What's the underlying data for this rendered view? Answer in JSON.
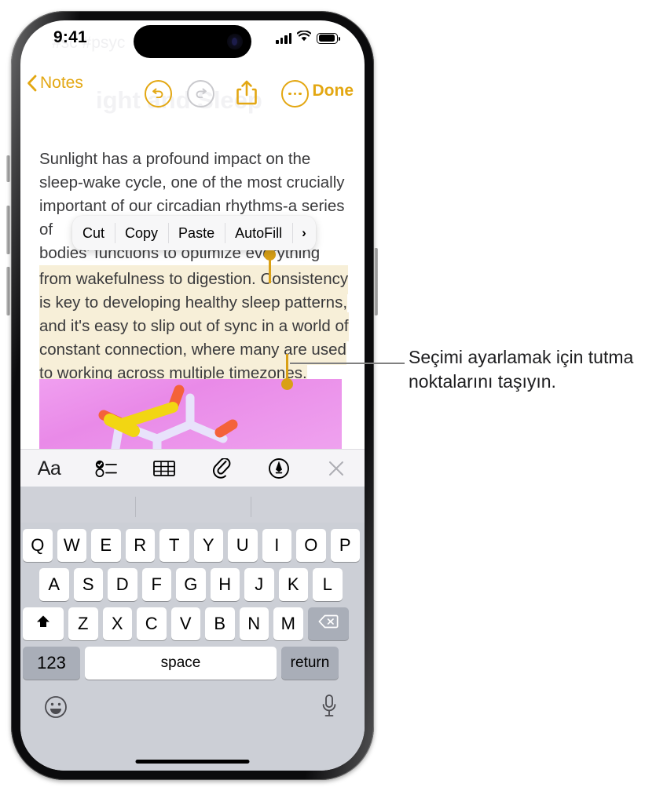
{
  "status_bar": {
    "time": "9:41",
    "signal_icon": "cellular-signal-icon",
    "wifi_icon": "wifi-icon",
    "battery_icon": "battery-full-icon"
  },
  "ghost": {
    "tags": "#sc        #psyc",
    "title": "ight and Sleep"
  },
  "nav_bar": {
    "back_label": "Notes",
    "back_icon": "chevron-left-icon",
    "undo_icon": "undo-arrow-icon",
    "redo_icon": "redo-arrow-icon",
    "share_icon": "share-up-arrow-icon",
    "more_icon": "ellipsis-circle-icon",
    "done_label": "Done"
  },
  "note": {
    "lines": [
      "Sunlight has a profound impact on the",
      "sleep-wake cycle, one of the most crucially",
      "important of our circadian rhythms-a series",
      "of ",
      "bodies' functions to optimize everything"
    ],
    "selected_lines": [
      "from wakefulness to digestion. Consistency",
      "is key to developing healthy sleep patterns,",
      "and it's easy to slip out of sync in a world of",
      "constant connection, where many are used",
      "to working across multiple timezones."
    ],
    "highlight_color": "#F7EFD8",
    "handle_color": "#D9A016",
    "image_alt": "molecule-illustration"
  },
  "context_menu": {
    "items": [
      {
        "label": "Cut"
      },
      {
        "label": "Copy"
      },
      {
        "label": "Paste"
      },
      {
        "label": "AutoFill"
      }
    ],
    "more_arrow": "›"
  },
  "format_toolbar": {
    "items": [
      {
        "label": "Aa",
        "icon": "text-format-icon"
      },
      {
        "label": "",
        "icon": "checklist-icon"
      },
      {
        "label": "",
        "icon": "table-icon"
      },
      {
        "label": "",
        "icon": "paperclip-icon"
      },
      {
        "label": "",
        "icon": "markup-pen-icon"
      },
      {
        "label": "",
        "icon": "close-icon"
      }
    ]
  },
  "keyboard": {
    "row1": [
      "Q",
      "W",
      "E",
      "R",
      "T",
      "Y",
      "U",
      "I",
      "O",
      "P"
    ],
    "row2": [
      "A",
      "S",
      "D",
      "F",
      "G",
      "H",
      "J",
      "K",
      "L"
    ],
    "row3": [
      "Z",
      "X",
      "C",
      "V",
      "B",
      "N",
      "M"
    ],
    "shift_icon": "shift-up-arrow-icon",
    "backspace_icon": "backspace-delete-icon",
    "numbers_label": "123",
    "space_label": "space",
    "return_label": "return",
    "emoji_icon": "emoji-smiley-icon",
    "mic_icon": "microphone-icon"
  },
  "callout": {
    "text": "Seçimi ayarlamak için tutma noktalarını taşıyın."
  },
  "colors": {
    "accent": "#E3A712",
    "highlight": "#F7EFD8",
    "handle": "#D9A016",
    "keyboard_bg": "#CCCFD6"
  }
}
